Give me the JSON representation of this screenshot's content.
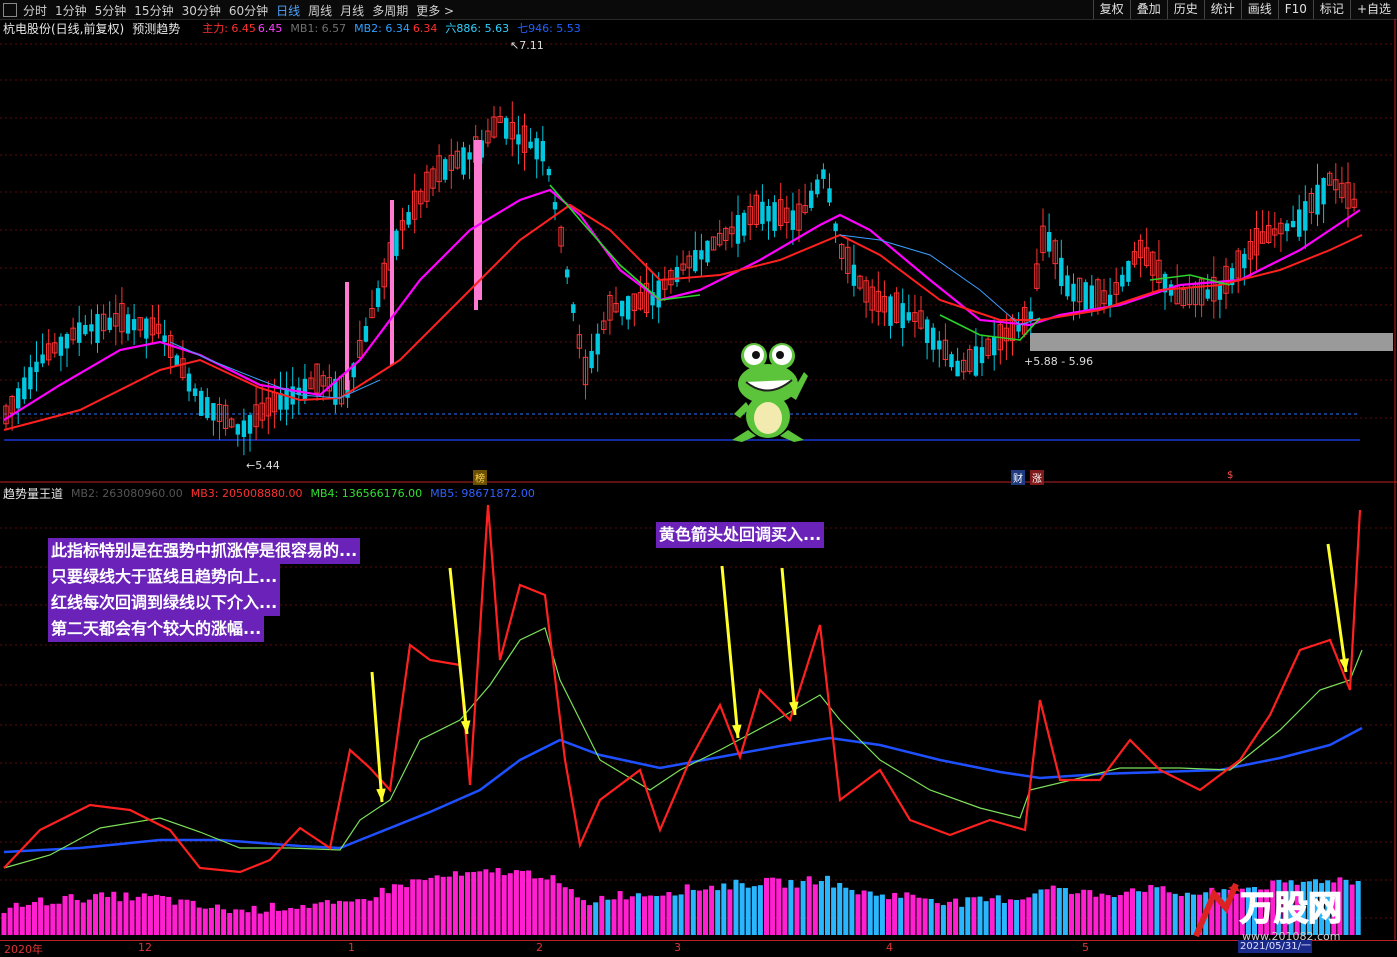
{
  "toolbar": {
    "periods": [
      "分时",
      "1分钟",
      "5分钟",
      "15分钟",
      "30分钟",
      "60分钟",
      "日线",
      "周线",
      "月线",
      "多周期",
      "更多 >"
    ],
    "active_period": "日线",
    "right_buttons": [
      "复权",
      "叠加",
      "历史",
      "统计",
      "画线",
      "F10",
      "标记",
      "+自选"
    ]
  },
  "main_header": {
    "stock": "杭电股份(日线,前复权)",
    "indicator": "预测趋势",
    "main_label": "主力: 6.45",
    "main_value2": "6.45",
    "mb1": "MB1: 6.57",
    "mb2": "MB2: 6.34",
    "mb2_val2": "6.34",
    "six": "六886: 5.63",
    "seven": "七946: 5.53"
  },
  "price_labels": {
    "high": "7.11",
    "low": "5.44",
    "zone": "5.88 - 5.96"
  },
  "markers": {
    "bang": "榜",
    "cai": "财",
    "zhang": "涨",
    "dollar": "$"
  },
  "sub_header": {
    "name": "趋势量王道",
    "mb2": "MB2: 263080960.00",
    "mb3": "MB3: 205008880.00",
    "mb4": "MB4: 136566176.00",
    "mb5": "MB5: 98671872.00"
  },
  "notes": {
    "left_lines": [
      "此指标特别是在强势中抓涨停是很容易的...",
      "只要绿线大于蓝线且趋势向上...",
      "红线每次回调到绿线以下介入...",
      "第二天都会有个较大的涨幅..."
    ],
    "top": "黄色箭头处回调买入..."
  },
  "time_axis": {
    "labels": [
      "2020年",
      "12",
      "1",
      "2",
      "3",
      "4",
      "5"
    ],
    "cursor_date": "2021/05/31/一"
  },
  "logo": {
    "brand": "万股网",
    "url": "www.201082.com"
  },
  "colors": {
    "up": "#ff3232",
    "down": "#00c8e0",
    "ma_magenta": "#ff00ff",
    "ma_red": "#ff2020",
    "ma_blue": "#1e50ff",
    "ma_green": "#2ad42a",
    "note_bg": "#6a22b8"
  }
}
